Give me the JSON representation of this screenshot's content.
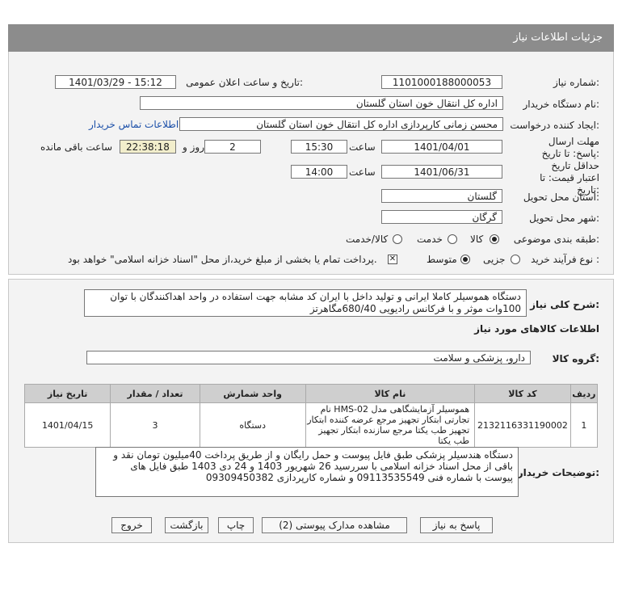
{
  "header": {
    "title": "جزئیات اطلاعات نیاز"
  },
  "form": {
    "need_number_label": "شماره نیاز:",
    "need_number": "1101000188000053",
    "announce_label": "تاریخ و ساعت اعلان عمومی:",
    "announce_value": "1401/03/29 - 15:12",
    "buyer_label": "نام دستگاه خریدار:",
    "buyer_value": "اداره کل انتقال خون استان گلستان",
    "creator_label": "ایجاد کننده درخواست:",
    "creator_value": "محسن زمانی کارپردازی اداره کل انتقال خون استان گلستان",
    "contact_link": "اطلاعات تماس خریدار",
    "deadline_label": "مهلت ارسال پاسخ: تا تاریخ:",
    "deadline_date": "1401/04/01",
    "time_label": "ساعت",
    "deadline_time": "15:30",
    "days_value": "2",
    "days_label": "روز و",
    "remaining_time": "22:38:18",
    "remaining_label": "ساعت باقی مانده",
    "validity_label": "حداقل تاریخ اعتبار قیمت: تا تاریخ:",
    "validity_date": "1401/06/31",
    "validity_time_label": "ساعت",
    "validity_time": "14:00",
    "province_label": "استان محل تحویل:",
    "province_value": "گلستان",
    "city_label": "شهر محل تحویل:",
    "city_value": "گرگان",
    "category_label": "طبقه بندی موضوعی:",
    "category_options": [
      "کالا",
      "خدمت",
      "کالا/خدمت"
    ],
    "process_label": "نوع فرآیند خرید :",
    "process_options": [
      "جزیی",
      "متوسط"
    ],
    "treasury_note": "پرداخت تمام یا بخشی از مبلغ خرید،از محل \"اسناد خزانه اسلامی\" خواهد بود."
  },
  "details": {
    "summary_label": "شرح کلی نیاز:",
    "summary_text": "دستگاه هموسیلر کاملا ایرانی و تولید داخل با ایران کد مشابه جهت استفاده در واحد اهداکنندگان با توان 100وات موثر و با فرکانس رادیویی 680/40مگاهرتز",
    "goods_title": "اطلاعات کالاهای مورد نیاز",
    "group_label": "گروه کالا:",
    "group_value": "دارو، پزشکی و سلامت",
    "table": {
      "headers": [
        "ردیف",
        "کد کالا",
        "نام کالا",
        "واحد شمارش",
        "تعداد / مقدار",
        "تاریخ نیاز"
      ],
      "rows": [
        [
          "1",
          "2132116331190002",
          "هموسیلر آزمایشگاهی مدل HMS-02 نام تجارتی ابتکار تجهیز مرجع عرضه کننده ابتکار تجهیز طب یکتا مرجع سازنده ابتکار تجهیز طب یکتا",
          "دستگاه",
          "3",
          "1401/04/15"
        ]
      ]
    },
    "buyer_notes_label": "توضیحات خریدار:",
    "buyer_notes": "دستگاه هندسیلر پزشکی طبق فایل پیوست و حمل رایگان و از طریق پرداخت 40میلیون تومان نقد و باقی از محل اسناد خزانه اسلامی با سررسید 26 شهریور 1403 و 24 دی 1403 طبق فایل های پیوست با شماره فنی 09113535549 و شماره کارپردازی 09309450382"
  },
  "buttons": {
    "reply": "پاسخ به نیاز",
    "attachments": "مشاهده مدارک پیوستی (2)",
    "print": "چاپ",
    "back": "بازگشت",
    "exit": "خروج"
  }
}
